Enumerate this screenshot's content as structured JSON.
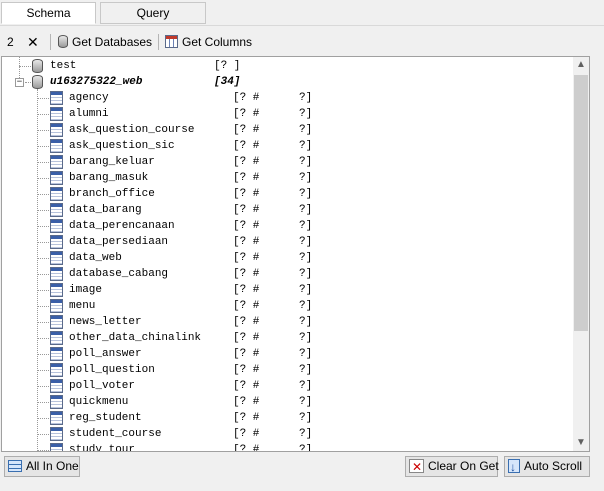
{
  "tabs": [
    {
      "label": "Schema",
      "active": true
    },
    {
      "label": "Query",
      "active": false
    }
  ],
  "toolbar": {
    "count": "2",
    "close_glyph": "✕",
    "get_databases": "Get Databases",
    "get_columns": "Get Columns"
  },
  "tree": {
    "databases": [
      {
        "name": "test",
        "tag": "[? ]"
      },
      {
        "name": "u163275322_web",
        "tag": "[34]"
      }
    ],
    "tables": [
      {
        "name": "agency",
        "info": "[? #      ?]"
      },
      {
        "name": "alumni",
        "info": "[? #      ?]"
      },
      {
        "name": "ask_question_course",
        "info": "[? #      ?]"
      },
      {
        "name": "ask_question_sic",
        "info": "[? #      ?]"
      },
      {
        "name": "barang_keluar",
        "info": "[? #      ?]"
      },
      {
        "name": "barang_masuk",
        "info": "[? #      ?]"
      },
      {
        "name": "branch_office",
        "info": "[? #      ?]"
      },
      {
        "name": "data_barang",
        "info": "[? #      ?]"
      },
      {
        "name": "data_perencanaan",
        "info": "[? #      ?]"
      },
      {
        "name": "data_persediaan",
        "info": "[? #      ?]"
      },
      {
        "name": "data_web",
        "info": "[? #      ?]"
      },
      {
        "name": "database_cabang",
        "info": "[? #      ?]"
      },
      {
        "name": "image",
        "info": "[? #      ?]"
      },
      {
        "name": "menu",
        "info": "[? #      ?]"
      },
      {
        "name": "news_letter",
        "info": "[? #      ?]"
      },
      {
        "name": "other_data_chinalink",
        "info": "[? #      ?]"
      },
      {
        "name": "poll_answer",
        "info": "[? #      ?]"
      },
      {
        "name": "poll_question",
        "info": "[? #      ?]"
      },
      {
        "name": "poll_voter",
        "info": "[? #      ?]"
      },
      {
        "name": "quickmenu",
        "info": "[? #      ?]"
      },
      {
        "name": "reg_student",
        "info": "[? #      ?]"
      },
      {
        "name": "student_course",
        "info": "[? #      ?]"
      },
      {
        "name": "study_tour",
        "info": "[? #      ?]"
      }
    ]
  },
  "buttons": {
    "all_in_one": "All In One",
    "clear_on_get": "Clear On Get",
    "auto_scroll": "Auto Scroll"
  },
  "scrollbar": {
    "up_glyph": "▲",
    "down_glyph": "▼"
  }
}
